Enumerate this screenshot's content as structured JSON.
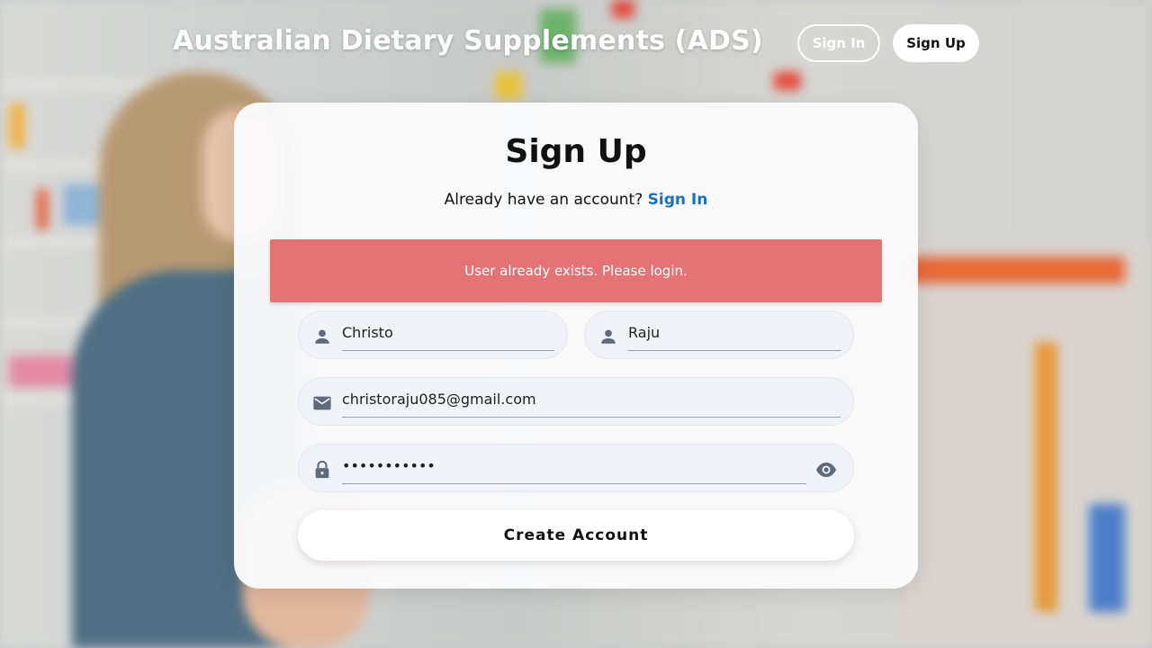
{
  "header": {
    "title": "Australian Dietary Supplements (ADS)",
    "signin_label": "Sign In",
    "signup_label": "Sign Up"
  },
  "card": {
    "title": "Sign Up",
    "prompt_text": "Already have an account?",
    "prompt_link": "Sign In",
    "alert": "User already exists. Please login."
  },
  "form": {
    "first_name": "Christo",
    "last_name": "Raju",
    "email": "christoraju085@gmail.com",
    "password_masked": "•••••••••••",
    "submit_label": "Create Account"
  },
  "colors": {
    "alert_bg": "#e57373",
    "link": "#1a6fc4",
    "icon": "#5f6b7a"
  },
  "icons": {
    "first_name": "person-icon",
    "last_name": "person-icon",
    "email": "mail-icon",
    "password": "lock-icon",
    "toggle": "eye-icon"
  }
}
